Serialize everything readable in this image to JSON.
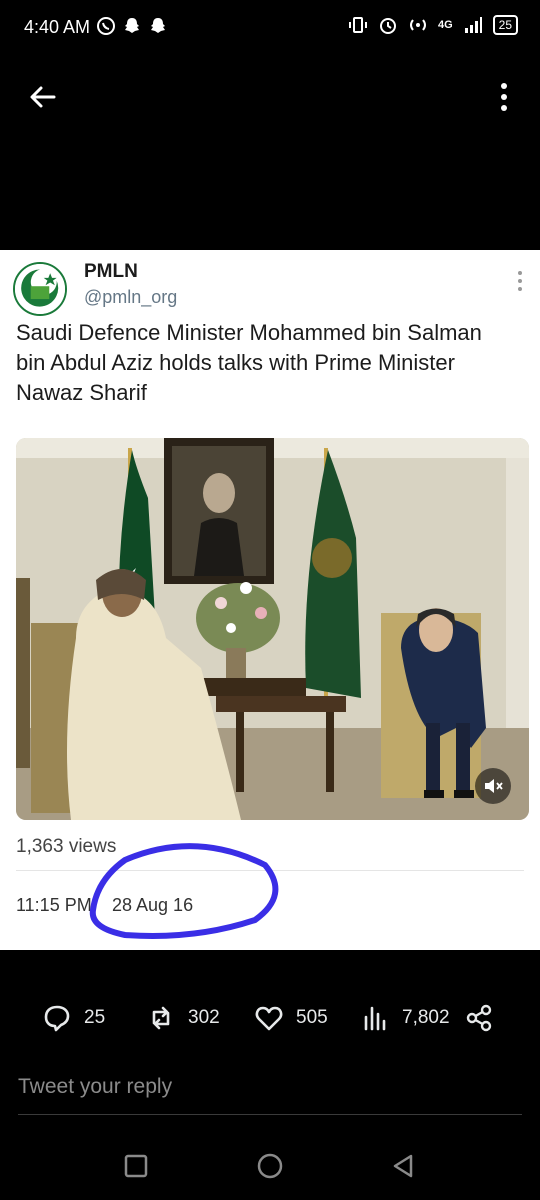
{
  "status_bar": {
    "time": "4:40 AM",
    "network": "4G",
    "battery": "25"
  },
  "tweet": {
    "author_name": "PMLN",
    "author_handle": "@pmln_org",
    "text": "Saudi Defence Minister Mohammed bin Salman bin Abdul Aziz holds talks with Prime Minister Nawaz Sharif",
    "views": "1,363 views",
    "time": "11:15 PM",
    "date": "28 Aug 16"
  },
  "actions": {
    "replies": "25",
    "retweets": "302",
    "likes": "505",
    "view_count": "7,802"
  },
  "reply": {
    "placeholder": "Tweet your reply"
  },
  "colors": {
    "annotation": "#3a2ee6",
    "pmln_green": "#1a7a3a",
    "background": "#000000"
  }
}
